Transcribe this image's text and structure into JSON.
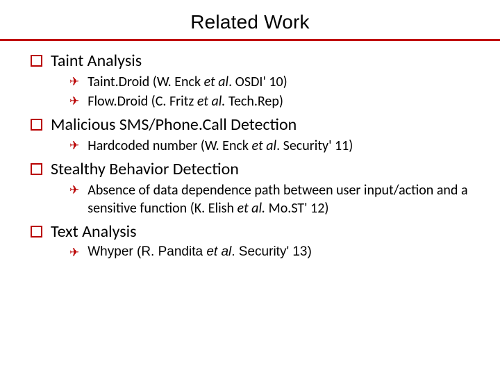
{
  "title": "Related Work",
  "sections": [
    {
      "heading": "Taint Analysis",
      "items": [
        {
          "pre": "Taint.Droid (W. Enck ",
          "em": "et al",
          "post": ". OSDI' 10)"
        },
        {
          "pre": "Flow.Droid (C. Fritz ",
          "em": "et al.",
          "post": " Tech.Rep)"
        }
      ]
    },
    {
      "heading": "Malicious SMS/Phone.Call Detection",
      "items": [
        {
          "pre": "Hardcoded number (W. Enck ",
          "em": "et al",
          "post": ". Security' 11)"
        }
      ]
    },
    {
      "heading": "Stealthy Behavior Detection",
      "items": [
        {
          "pre": "Absence of data dependence path between user input/action and a sensitive function  (K. Elish ",
          "em": "et al.",
          "post": " Mo.ST' 12)"
        }
      ]
    },
    {
      "heading": "Text Analysis",
      "items": [
        {
          "pre": "Whyper (R. Pandita ",
          "em": "et al",
          "post": ". Security' 13)",
          "arialish": true
        }
      ]
    }
  ],
  "glyphs": {
    "arrow": "✈"
  }
}
